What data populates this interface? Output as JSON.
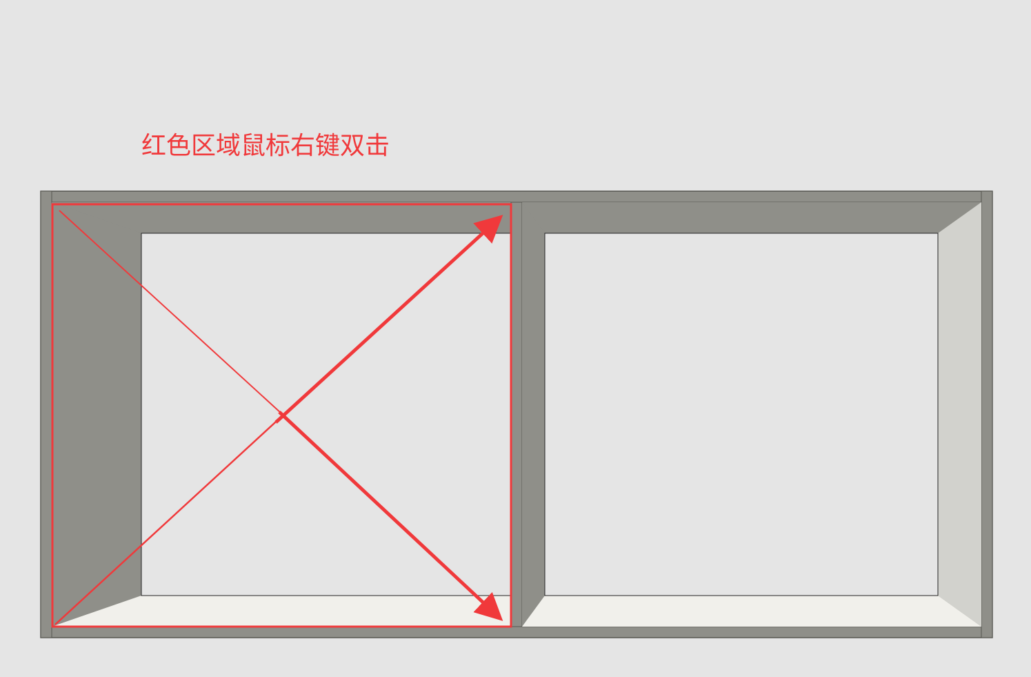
{
  "annotation": {
    "label": "红色区域鼠标右键双击"
  },
  "colors": {
    "background": "#e5e5e5",
    "frame": "#8f8f89",
    "frame_dark": "#7e7e78",
    "shadow_side": "#8f8f89",
    "light_side": "#d2d2cd",
    "floor": "#f1f0eb",
    "opening": "#e5e5e5",
    "highlight": "#f0393b"
  },
  "icons": {
    "arrow_up": "arrow-up-right-icon",
    "arrow_down": "arrow-down-right-icon"
  }
}
